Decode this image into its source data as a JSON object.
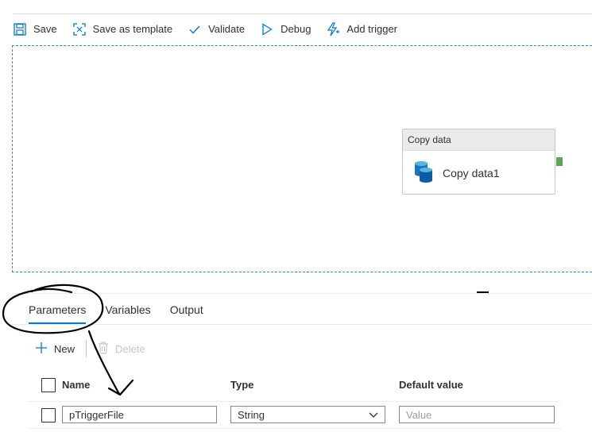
{
  "toolbar": {
    "save": "Save",
    "save_template": "Save as template",
    "validate": "Validate",
    "debug": "Debug",
    "add_trigger": "Add trigger"
  },
  "activity": {
    "header": "Copy data",
    "name": "Copy data1"
  },
  "tabs": [
    {
      "label": "Parameters",
      "active": true
    },
    {
      "label": "Variables",
      "active": false
    },
    {
      "label": "Output",
      "active": false
    }
  ],
  "actions": {
    "new": "New",
    "delete": "Delete"
  },
  "table": {
    "headers": {
      "name": "Name",
      "type": "Type",
      "default": "Default value"
    },
    "rows": [
      {
        "name": "pTriggerFile",
        "type": "String",
        "default_placeholder": "Value"
      }
    ]
  },
  "colors": {
    "accent": "#0078d4",
    "canvas_border": "#2b88d8",
    "port": "#5ea45b"
  }
}
